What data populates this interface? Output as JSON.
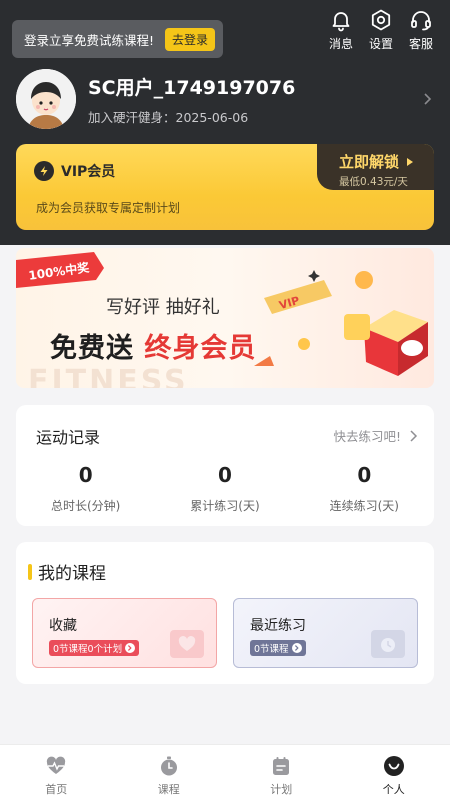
{
  "header": {
    "login_tip": "登录立享免费试练课程!",
    "login_button": "去登录",
    "actions": [
      {
        "icon": "bell-icon",
        "label": "消息"
      },
      {
        "icon": "gear-icon",
        "label": "设置"
      },
      {
        "icon": "headset-icon",
        "label": "客服"
      }
    ]
  },
  "profile": {
    "name": "SC用户_1749197076",
    "joined": "加入硬汗健身：2025-06-06"
  },
  "vip": {
    "title": "VIP会员",
    "description": "成为会员获取专属定制计划",
    "unlock_label": "立即解锁",
    "price_text": "最低0.43元/天"
  },
  "banner": {
    "ribbon": "100%中奖",
    "subtitle": "写好评  抽好礼",
    "headline_a": "免费送",
    "headline_b": "终身会员",
    "watermark": "FITNESS"
  },
  "records": {
    "title": "运动记录",
    "link": "快去练习吧!",
    "stats": [
      {
        "value": "0",
        "label": "总时长(分钟)"
      },
      {
        "value": "0",
        "label": "累计练习(天)"
      },
      {
        "value": "0",
        "label": "连续练习(天)"
      }
    ]
  },
  "courses": {
    "title": "我的课程",
    "favorites": {
      "title": "收藏",
      "tag": "0节课程0个计划"
    },
    "recent": {
      "title": "最近练习",
      "tag": "0节课程"
    }
  },
  "tabs": [
    {
      "icon": "heartbeat-icon",
      "label": "首页",
      "active": false
    },
    {
      "icon": "stopwatch-icon",
      "label": "课程",
      "active": false
    },
    {
      "icon": "calendar-icon",
      "label": "计划",
      "active": false
    },
    {
      "icon": "person-icon",
      "label": "个人",
      "active": true
    }
  ],
  "colors": {
    "header_bg": "#2b2d30",
    "accent_yellow": "#f5c518",
    "accent_red": "#e53935"
  }
}
